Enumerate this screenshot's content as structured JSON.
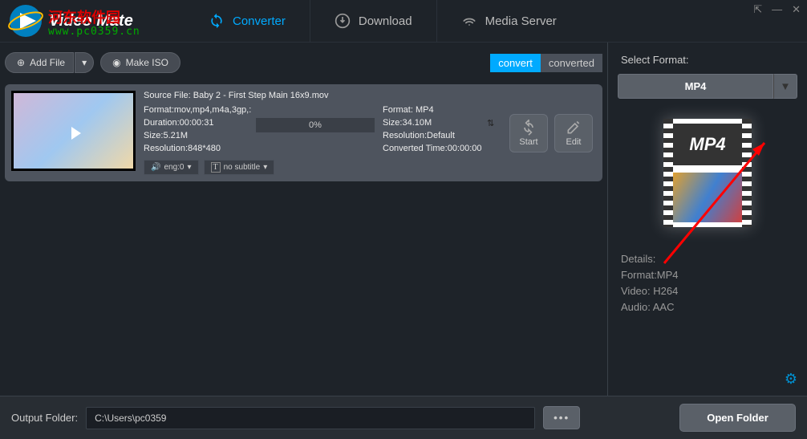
{
  "app": {
    "title": "Video Mate"
  },
  "watermark": {
    "line1": "河东软件园",
    "line2": "www.pc0359.cn"
  },
  "nav": {
    "converter": "Converter",
    "download": "Download",
    "media_server": "Media Server"
  },
  "toolbar": {
    "add_file": "Add File",
    "make_iso": "Make ISO",
    "convert": "convert",
    "converted": "converted"
  },
  "file": {
    "source_label": "Source File:",
    "source_name": "Baby 2 - First Step Main 16x9.mov",
    "src": {
      "format": "Format:mov,mp4,m4a,3gp,:",
      "duration": "Duration:00:00:31",
      "size": "Size:5.21M",
      "resolution": "Resolution:848*480"
    },
    "dst": {
      "format": "Format: MP4",
      "size": "Size:34.10M",
      "resolution": "Resolution:Default",
      "converted_time": "Converted Time:00:00:00"
    },
    "progress": "0%",
    "audio_track": "eng:0",
    "subtitle": "no subtitle",
    "start": "Start",
    "edit": "Edit"
  },
  "right": {
    "select_format": "Select Format:",
    "format": "MP4",
    "preview_label": "MP4",
    "details_label": "Details:",
    "detail_format": "Format:MP4",
    "detail_video": "Video: H264",
    "detail_audio": "Audio: AAC"
  },
  "footer": {
    "label": "Output Folder:",
    "path": "C:\\Users\\pc0359",
    "open_folder": "Open Folder"
  }
}
